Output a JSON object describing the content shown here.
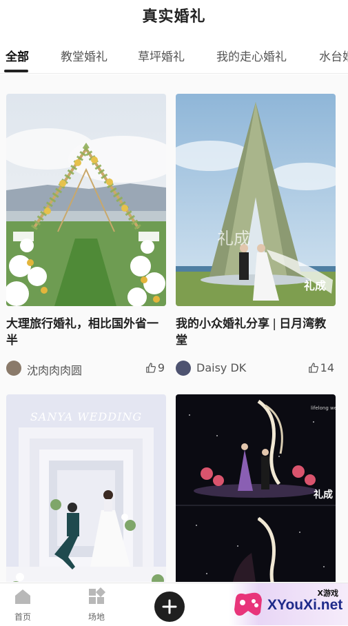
{
  "header": {
    "title": "真实婚礼"
  },
  "tabs": [
    {
      "label": "全部",
      "active": true
    },
    {
      "label": "教堂婚礼",
      "active": false
    },
    {
      "label": "草坪婚礼",
      "active": false
    },
    {
      "label": "我的走心婚礼",
      "active": false
    },
    {
      "label": "水台婚",
      "active": false
    }
  ],
  "feed": {
    "cards": [
      {
        "title": "大理旅行婚礼，相比国外省一半",
        "author": "沈肉肉肉圆",
        "likes": "9"
      },
      {
        "title": "我的小众婚礼分享❘日月湾教堂",
        "author": "Daisy DK",
        "likes": "14",
        "photo_text": {
          "watermark": "礼成",
          "sub": "礼成"
        }
      },
      {
        "title": "",
        "author": "",
        "likes": "",
        "photo_text": {
          "headline": "SANYA WEDDING"
        }
      },
      {
        "title": "",
        "author": "",
        "likes": "",
        "photo_text": {
          "top_label": "lifelong wedding",
          "logo": "礼成"
        }
      }
    ]
  },
  "tabbar": {
    "items": [
      {
        "label": "首页",
        "icon": "home-icon"
      },
      {
        "label": "场地",
        "icon": "venue-icon"
      },
      {
        "label": "",
        "icon": "plus-icon"
      }
    ]
  },
  "watermark": {
    "top": "X游戏",
    "main": "XYouXi.net"
  },
  "colors": {
    "accent": "#222222",
    "watermark_blue": "#1e2a8a",
    "pink": "#e8347a"
  }
}
